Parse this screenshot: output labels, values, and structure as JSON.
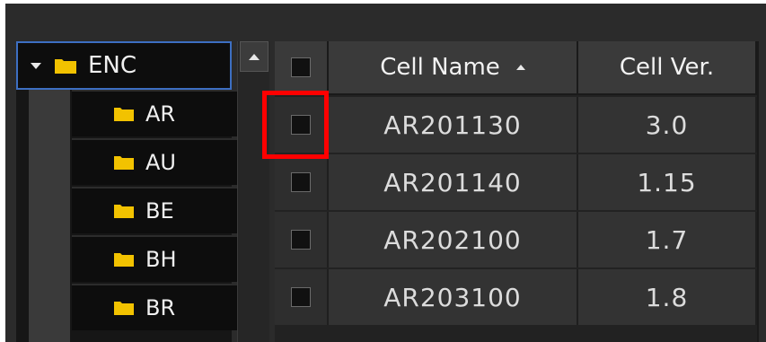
{
  "tree": {
    "root": {
      "label": "ENC",
      "expanded": true
    },
    "items": [
      {
        "label": "AR"
      },
      {
        "label": "AU"
      },
      {
        "label": "BE"
      },
      {
        "label": "BH"
      },
      {
        "label": "BR"
      }
    ]
  },
  "table": {
    "columns": [
      {
        "key": "select",
        "label": ""
      },
      {
        "key": "cell_name",
        "label": "Cell Name",
        "sorted": "ascending"
      },
      {
        "key": "cell_ver",
        "label": "Cell Ver."
      }
    ],
    "rows": [
      {
        "cell_name": "AR201130",
        "cell_ver": "3.0",
        "checked": false
      },
      {
        "cell_name": "AR201140",
        "cell_ver": "1.15",
        "checked": false
      },
      {
        "cell_name": "AR202100",
        "cell_ver": "1.7",
        "checked": false
      },
      {
        "cell_name": "AR203100",
        "cell_ver": "1.8",
        "checked": false
      }
    ]
  },
  "icons": {
    "folder": "folder-icon",
    "expand": "caret-down-icon",
    "scroll_up": "arrow-up-icon",
    "sort": "sort-ascending-icon"
  },
  "colors": {
    "folder": "#f2c200",
    "selection_border": "#3d6fc2",
    "highlight": "#ff0000"
  }
}
